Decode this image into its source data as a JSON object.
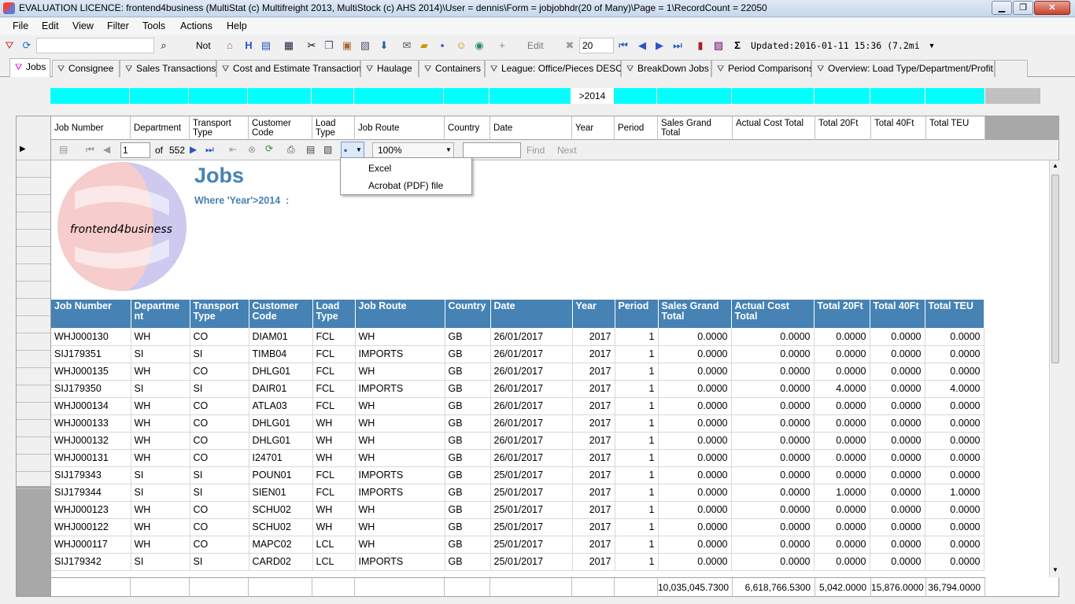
{
  "window": {
    "title": "EVALUATION LICENCE: frontend4business (MultiStat (c) Multifreight 2013, MultiStock (c) AHS 2014)\\User = dennis\\Form = jobjobhdr(20 of Many)\\Page = 1\\RecordCount = 22050",
    "minimize": "▁",
    "maximize": "❐",
    "close": "✕"
  },
  "menu": [
    "File",
    "Edit",
    "View",
    "Filter",
    "Tools",
    "Actions",
    "Help"
  ],
  "toolbar": {
    "not_label": "Not",
    "h_label": "H",
    "edit_label": "Edit",
    "count_value": "20",
    "updated_text": "Updated:2016-01-11 15:36 (7.2mi"
  },
  "tabs": [
    "Jobs",
    "Consignee",
    "Sales Transactions",
    "Cost and Estimate Transactions",
    "Haulage",
    "Containers",
    "League: Office/Pieces DESC",
    "BreakDown Jobs",
    "Period Comparisons",
    "Overview: Load Type/Department/Profit..."
  ],
  "filter": {
    "year": ">2014"
  },
  "columns": [
    "Job Number",
    "Department",
    "Transport Type",
    "Customer Code",
    "Load Type",
    "Job Route",
    "Country",
    "Date",
    "Year",
    "Period",
    "Sales Grand Total",
    "Actual Cost Total",
    "Total 20Ft",
    "Total 40Ft",
    "Total TEU"
  ],
  "report_toolbar": {
    "page": "1",
    "of": "of",
    "total_pages": "552",
    "zoom": "100%",
    "find": "Find",
    "next": "Next"
  },
  "export_menu": [
    "Excel",
    "Acrobat (PDF) file"
  ],
  "report": {
    "title": "Jobs",
    "subtitle": "Where 'Year'>2014  :",
    "logo_text": "frontend4business",
    "headers": [
      "Job Number",
      "Departme nt",
      "Transport Type",
      "Customer Code",
      "Load Type",
      "Job Route",
      "Country",
      "Date",
      "Year",
      "Period",
      "Sales Grand Total",
      "Actual Cost Total",
      "Total 20Ft",
      "Total 40Ft",
      "Total TEU"
    ],
    "rows": [
      [
        "WHJ000130",
        "WH",
        "CO",
        "DIAM01",
        "FCL",
        "WH",
        "GB",
        "26/01/2017",
        "2017",
        "1",
        "0.0000",
        "0.0000",
        "0.0000",
        "0.0000",
        "0.0000"
      ],
      [
        "SIJ179351",
        "SI",
        "SI",
        "TIMB04",
        "FCL",
        "IMPORTS",
        "GB",
        "26/01/2017",
        "2017",
        "1",
        "0.0000",
        "0.0000",
        "0.0000",
        "0.0000",
        "0.0000"
      ],
      [
        "WHJ000135",
        "WH",
        "CO",
        "DHLG01",
        "FCL",
        "WH",
        "GB",
        "26/01/2017",
        "2017",
        "1",
        "0.0000",
        "0.0000",
        "0.0000",
        "0.0000",
        "0.0000"
      ],
      [
        "SIJ179350",
        "SI",
        "SI",
        "DAIR01",
        "FCL",
        "IMPORTS",
        "GB",
        "26/01/2017",
        "2017",
        "1",
        "0.0000",
        "0.0000",
        "4.0000",
        "0.0000",
        "4.0000"
      ],
      [
        "WHJ000134",
        "WH",
        "CO",
        "ATLA03",
        "FCL",
        "WH",
        "GB",
        "26/01/2017",
        "2017",
        "1",
        "0.0000",
        "0.0000",
        "0.0000",
        "0.0000",
        "0.0000"
      ],
      [
        "WHJ000133",
        "WH",
        "CO",
        "DHLG01",
        "WH",
        "WH",
        "GB",
        "26/01/2017",
        "2017",
        "1",
        "0.0000",
        "0.0000",
        "0.0000",
        "0.0000",
        "0.0000"
      ],
      [
        "WHJ000132",
        "WH",
        "CO",
        "DHLG01",
        "WH",
        "WH",
        "GB",
        "26/01/2017",
        "2017",
        "1",
        "0.0000",
        "0.0000",
        "0.0000",
        "0.0000",
        "0.0000"
      ],
      [
        "WHJ000131",
        "WH",
        "CO",
        "I24701",
        "WH",
        "WH",
        "GB",
        "26/01/2017",
        "2017",
        "1",
        "0.0000",
        "0.0000",
        "0.0000",
        "0.0000",
        "0.0000"
      ],
      [
        "SIJ179343",
        "SI",
        "SI",
        "POUN01",
        "FCL",
        "IMPORTS",
        "GB",
        "25/01/2017",
        "2017",
        "1",
        "0.0000",
        "0.0000",
        "0.0000",
        "0.0000",
        "0.0000"
      ],
      [
        "SIJ179344",
        "SI",
        "SI",
        "SIEN01",
        "FCL",
        "IMPORTS",
        "GB",
        "25/01/2017",
        "2017",
        "1",
        "0.0000",
        "0.0000",
        "1.0000",
        "0.0000",
        "1.0000"
      ],
      [
        "WHJ000123",
        "WH",
        "CO",
        "SCHU02",
        "WH",
        "WH",
        "GB",
        "25/01/2017",
        "2017",
        "1",
        "0.0000",
        "0.0000",
        "0.0000",
        "0.0000",
        "0.0000"
      ],
      [
        "WHJ000122",
        "WH",
        "CO",
        "SCHU02",
        "WH",
        "WH",
        "GB",
        "25/01/2017",
        "2017",
        "1",
        "0.0000",
        "0.0000",
        "0.0000",
        "0.0000",
        "0.0000"
      ],
      [
        "WHJ000117",
        "WH",
        "CO",
        "MAPC02",
        "LCL",
        "WH",
        "GB",
        "25/01/2017",
        "2017",
        "1",
        "0.0000",
        "0.0000",
        "0.0000",
        "0.0000",
        "0.0000"
      ],
      [
        "SIJ179342",
        "SI",
        "SI",
        "CARD02",
        "LCL",
        "IMPORTS",
        "GB",
        "25/01/2017",
        "2017",
        "1",
        "0.0000",
        "0.0000",
        "0.0000",
        "0.0000",
        "0.0000"
      ]
    ]
  },
  "totals": {
    "sales": "10,035,045.7300",
    "cost": "6,618,766.5300",
    "t20": "5,042.0000",
    "t40": "15,876.0000",
    "teu": "36,794.0000"
  }
}
